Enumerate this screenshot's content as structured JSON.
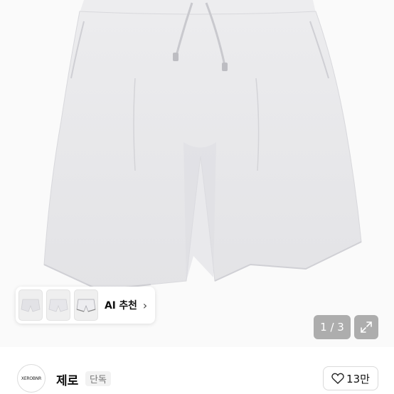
{
  "product": {
    "image_alt": "Light gray sweat shorts with drawstring",
    "image_counter": "1 / 3"
  },
  "recommend": {
    "label": "AI 추천",
    "thumbnails": [
      "thumb-1",
      "thumb-2",
      "thumb-3"
    ]
  },
  "store": {
    "logo_text": "XEROBNR",
    "name": "제로",
    "badge": "단독"
  },
  "likes": {
    "count": "13만"
  },
  "colors": {
    "garment": "#e9e9eb",
    "overlay": "#6e6e6e"
  }
}
